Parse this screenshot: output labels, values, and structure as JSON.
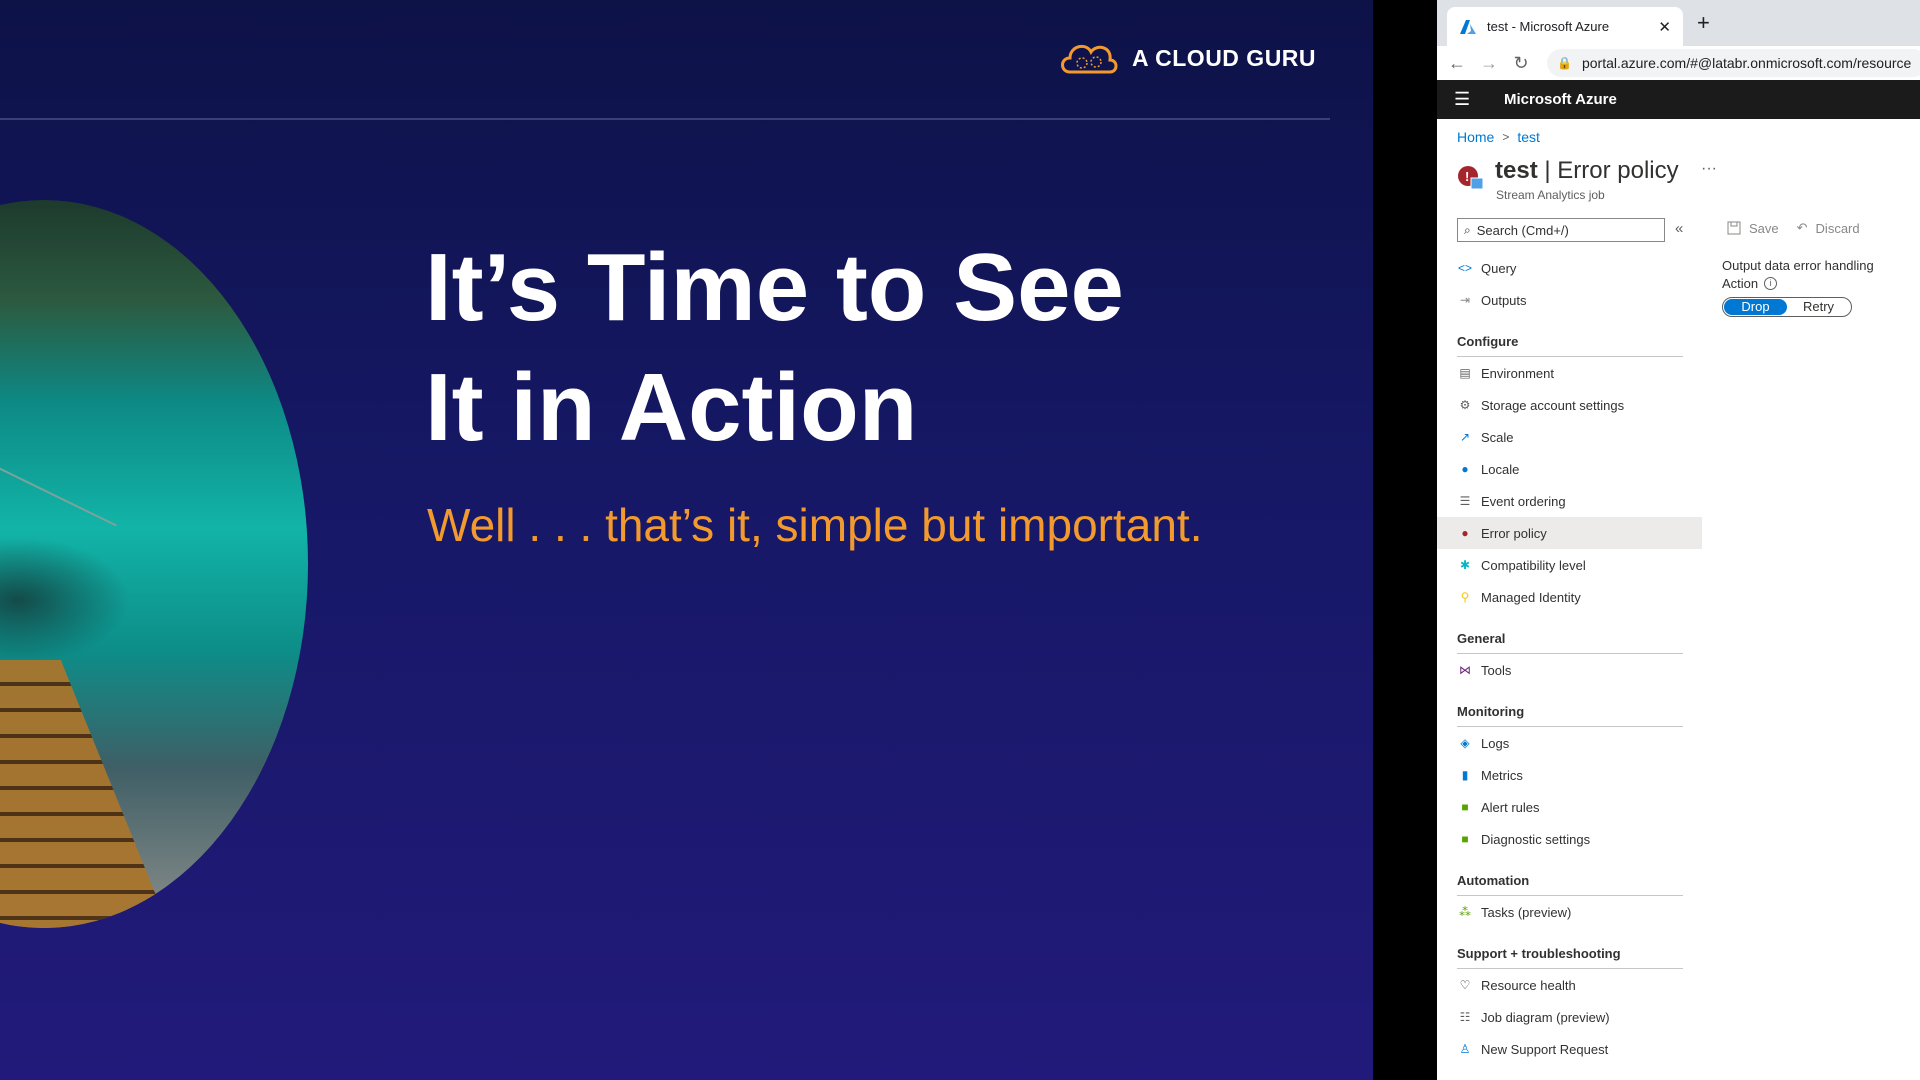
{
  "slide": {
    "logo_text": "A CLOUD GURU",
    "headline_line1": "It’s Time to See",
    "headline_line2": "It in Action",
    "subtitle": "Well . . . that’s it, simple but important.",
    "colors": {
      "background": "#161866",
      "subtitle": "#f29a2e",
      "logo_accent": "#f29a2e"
    }
  },
  "browser": {
    "tab_title": "test - Microsoft Azure",
    "tab_close": "✕",
    "new_tab": "+",
    "url": "portal.azure.com/#@latabr.onmicrosoft.com/resource",
    "nav": {
      "back": "←",
      "forward": "→",
      "reload": "↻"
    }
  },
  "portal": {
    "brand": "Microsoft Azure",
    "breadcrumb": {
      "home": "Home",
      "separator": ">",
      "current": "test"
    },
    "title_resource": "test",
    "title_separator": " | ",
    "title_page": "Error policy",
    "resource_type": "Stream Analytics job",
    "more": "···",
    "search_placeholder": "Search (Cmd+/)",
    "collapse": "«",
    "menu": {
      "top": [
        {
          "icon": "code-icon",
          "glyph": "<>",
          "label": "Query"
        },
        {
          "icon": "outputs-icon",
          "glyph": "⇥",
          "label": "Outputs"
        }
      ],
      "configure": {
        "title": "Configure",
        "items": [
          {
            "icon": "environment-icon",
            "glyph": "▤",
            "label": "Environment"
          },
          {
            "icon": "gear-icon",
            "glyph": "⚙",
            "label": "Storage account settings"
          },
          {
            "icon": "scale-icon",
            "glyph": "↗",
            "label": "Scale"
          },
          {
            "icon": "globe-icon",
            "glyph": "●",
            "label": "Locale"
          },
          {
            "icon": "event-ordering-icon",
            "glyph": "☰",
            "label": "Event ordering"
          },
          {
            "icon": "error-policy-icon",
            "glyph": "●",
            "label": "Error policy",
            "selected": true
          },
          {
            "icon": "compatibility-icon",
            "glyph": "✱",
            "label": "Compatibility level"
          },
          {
            "icon": "key-icon",
            "glyph": "⚲",
            "label": "Managed Identity"
          }
        ]
      },
      "general": {
        "title": "General",
        "items": [
          {
            "icon": "tools-icon",
            "glyph": "⋈",
            "label": "Tools"
          }
        ]
      },
      "monitoring": {
        "title": "Monitoring",
        "items": [
          {
            "icon": "logs-icon",
            "glyph": "◈",
            "label": "Logs"
          },
          {
            "icon": "metrics-icon",
            "glyph": "▮",
            "label": "Metrics"
          },
          {
            "icon": "alert-icon",
            "glyph": "■",
            "label": "Alert rules"
          },
          {
            "icon": "diagnostic-icon",
            "glyph": "■",
            "label": "Diagnostic settings"
          }
        ]
      },
      "automation": {
        "title": "Automation",
        "items": [
          {
            "icon": "tasks-icon",
            "glyph": "⁂",
            "label": "Tasks (preview)"
          }
        ]
      },
      "support": {
        "title": "Support + troubleshooting",
        "items": [
          {
            "icon": "heart-icon",
            "glyph": "♡",
            "label": "Resource health"
          },
          {
            "icon": "diagram-icon",
            "glyph": "☷",
            "label": "Job diagram (preview)"
          },
          {
            "icon": "support-icon",
            "glyph": "♙",
            "label": "New Support Request"
          }
        ]
      }
    },
    "toolbar": {
      "save": "Save",
      "discard": "Discard"
    },
    "content": {
      "heading": "Output data error handling",
      "action_label": "Action",
      "options": [
        "Drop",
        "Retry"
      ],
      "selected": "Drop"
    },
    "colors": {
      "link": "#0078d4",
      "header": "#1b1b1b",
      "toggle_active": "#0078d4"
    }
  }
}
